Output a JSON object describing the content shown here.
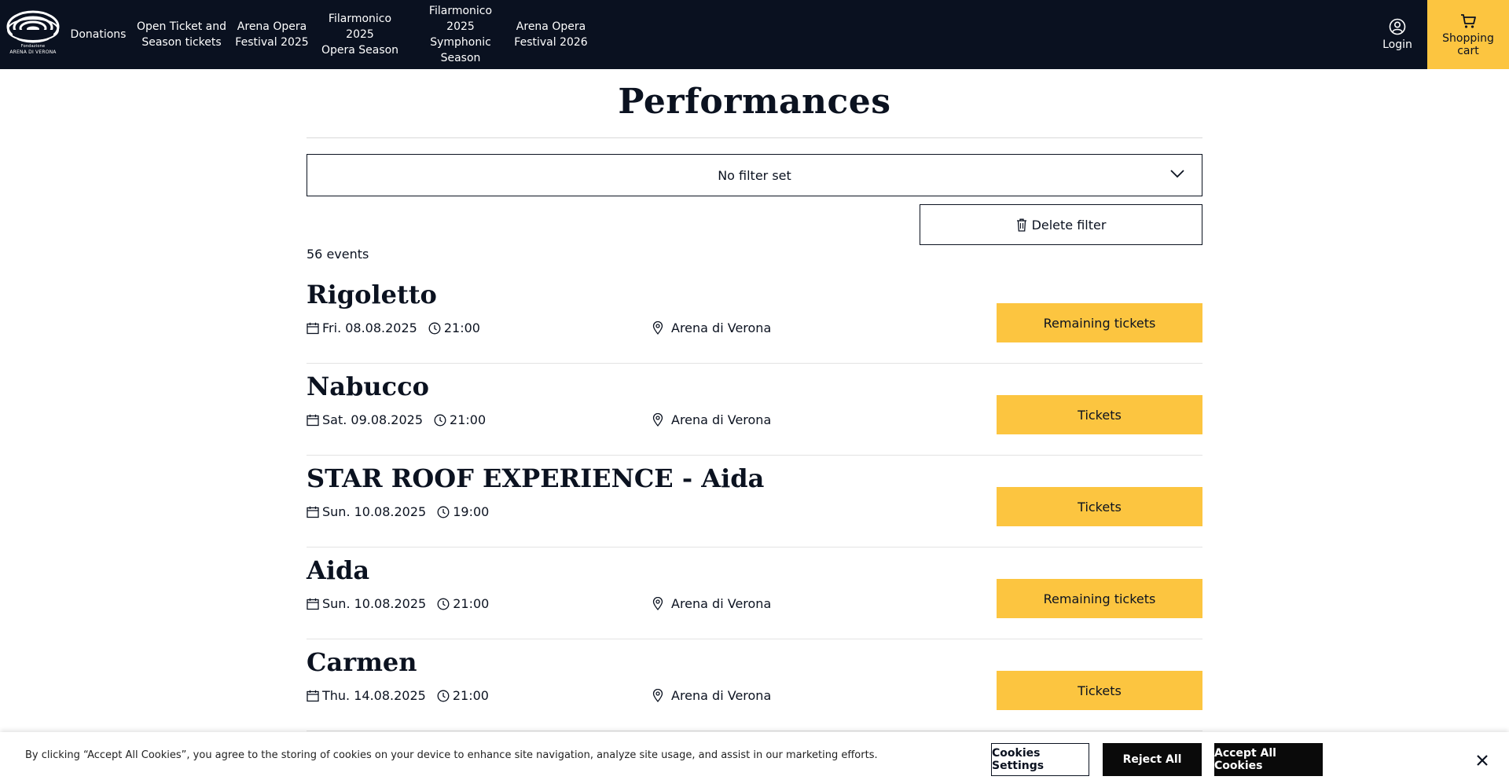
{
  "header": {
    "logo_line1": "Fondazione",
    "logo_line2": "ARENA DI VERONA",
    "nav": [
      "Donations",
      "Open Ticket and\nSeason tickets",
      "Arena Opera\nFestival 2025",
      "Filarmonico 2025\nOpera Season",
      "Filarmonico 2025\nSymphonic\nSeason",
      "Arena Opera\nFestival 2026"
    ],
    "login_label": "Login",
    "cart_label": "Shopping\ncart"
  },
  "main": {
    "title": "Performances",
    "filter_label": "No filter set",
    "delete_filter_label": "Delete filter",
    "count_label": "56 events"
  },
  "events": [
    {
      "title": "Rigoletto",
      "date": "Fri.  08.08.2025",
      "time": "21:00",
      "venue": "Arena di Verona",
      "button": "Remaining tickets"
    },
    {
      "title": "Nabucco",
      "date": "Sat. 09.08.2025",
      "time": "21:00",
      "venue": "Arena di Verona",
      "button": "Tickets"
    },
    {
      "title": "STAR ROOF EXPERIENCE - Aida",
      "date": "Sun. 10.08.2025",
      "time": "19:00",
      "venue": "",
      "button": "Tickets"
    },
    {
      "title": "Aida",
      "date": "Sun. 10.08.2025",
      "time": "21:00",
      "venue": "Arena di Verona",
      "button": "Remaining tickets"
    },
    {
      "title": "Carmen",
      "date": "Thu. 14.08.2025",
      "time": "21:00",
      "venue": "Arena di Verona",
      "button": "Tickets"
    }
  ],
  "cookie": {
    "text": "By clicking “Accept All Cookies”, you agree to the storing of cookies on your device to enhance site navigation, analyze site usage, and assist in our marketing efforts.",
    "settings_label": "Cookies Settings",
    "reject_label": "Reject All",
    "accept_label": "Accept All Cookies"
  },
  "colors": {
    "header_bg": "#0a1120",
    "accent": "#fcc540"
  },
  "icons": [
    "arena-logo",
    "user-icon",
    "cart-icon",
    "chevron-down-icon",
    "trash-icon",
    "calendar-icon",
    "clock-icon",
    "location-pin-icon",
    "close-icon"
  ]
}
